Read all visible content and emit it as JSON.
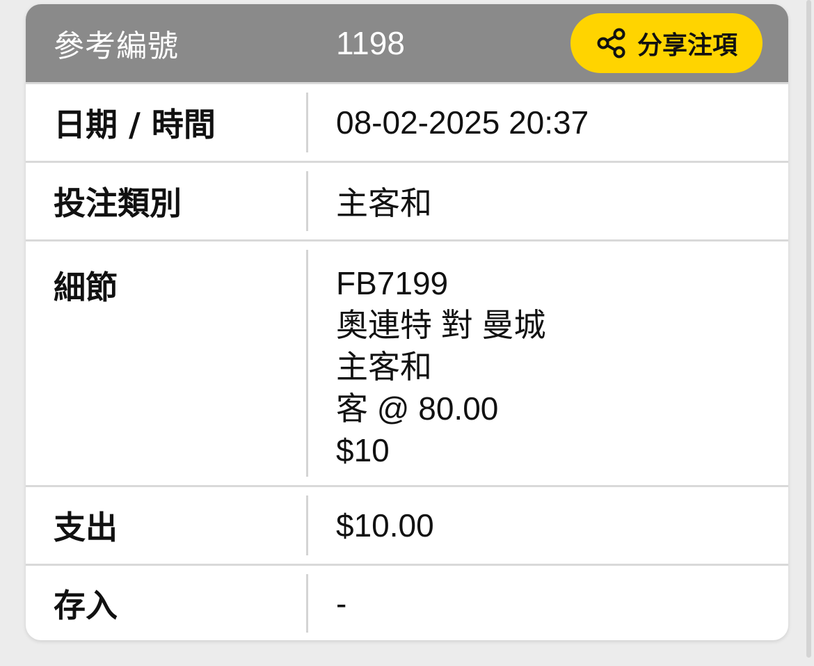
{
  "header": {
    "ref_label": "參考編號",
    "ref_number": "1198",
    "share_label": "分享注項"
  },
  "rows": {
    "datetime": {
      "label": "日期 / 時間",
      "value": "08-02-2025 20:37"
    },
    "bet_type": {
      "label": "投注類別",
      "value": "主客和"
    },
    "details": {
      "label": "細節",
      "lines": [
        "FB7199",
        "奧連特 對 曼城",
        "主客和",
        "客 @ 80.00",
        "$10"
      ]
    },
    "expenditure": {
      "label": "支出",
      "value": "$10.00"
    },
    "deposit": {
      "label": "存入",
      "value": "-"
    }
  },
  "icons": {
    "share": "share-icon"
  },
  "colors": {
    "header_bg": "#8a8a8a",
    "accent": "#ffd400"
  }
}
